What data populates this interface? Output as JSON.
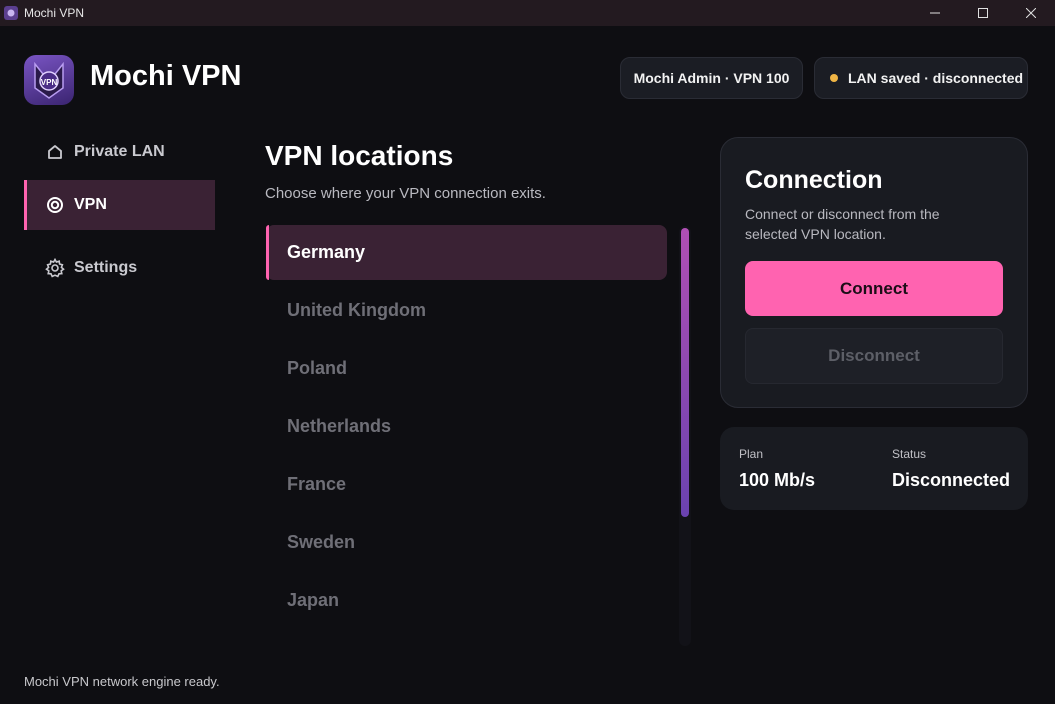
{
  "window": {
    "title": "Mochi VPN"
  },
  "header": {
    "app_name": "Mochi VPN",
    "account_badge": "Mochi Admin · VPN 100",
    "lan_status_badge": "LAN saved · disconnected",
    "logo_text": "VPN"
  },
  "sidebar": {
    "items": [
      {
        "label": "Private LAN",
        "icon": "home-icon",
        "active": false
      },
      {
        "label": "VPN",
        "icon": "vpn-icon",
        "active": true
      },
      {
        "label": "Settings",
        "icon": "gear-icon",
        "active": false
      }
    ],
    "footer_status": "Mochi VPN network engine ready."
  },
  "main": {
    "title": "VPN locations",
    "subtitle": "Choose where your VPN connection exits.",
    "locations": [
      "Germany",
      "United Kingdom",
      "Poland",
      "Netherlands",
      "France",
      "Sweden",
      "Japan"
    ],
    "selected_location": "Germany"
  },
  "connection": {
    "title": "Connection",
    "description": "Connect or disconnect from the selected VPN location.",
    "connect_label": "Connect",
    "disconnect_label": "Disconnect"
  },
  "info": {
    "plan_label": "Plan",
    "plan_value": "100 Mb/s",
    "status_label": "Status",
    "status_value": "Disconnected"
  },
  "colors": {
    "accent": "#ff63b0",
    "background": "#0e0e12",
    "card": "#191b21",
    "active_nav": "#3a2234",
    "status_dot": "#f0b545"
  }
}
